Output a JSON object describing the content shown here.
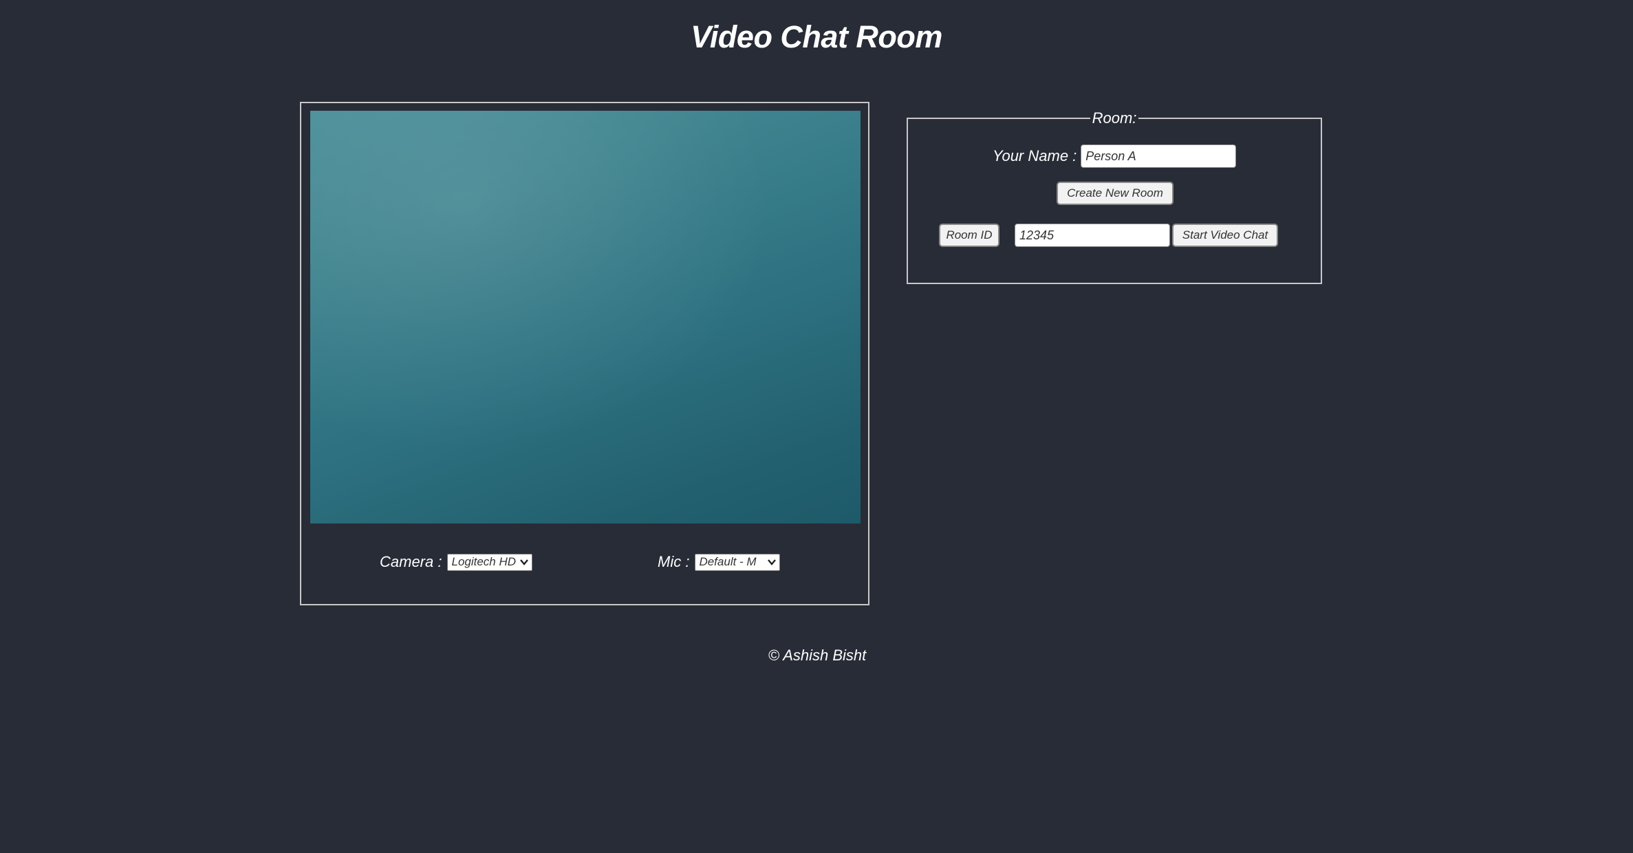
{
  "page": {
    "title": "Video Chat Room",
    "footer": "© Ashish Bisht"
  },
  "video": {
    "camera_label": "Camera :",
    "camera_selected": "Logitech HD",
    "mic_label": "Mic :",
    "mic_selected": "Default - M"
  },
  "room": {
    "legend": "Room:",
    "name_label": "Your Name :",
    "name_value": "Person A",
    "create_button": "Create New Room",
    "room_id_button": "Room ID",
    "room_id_value": "12345",
    "start_button": "Start Video Chat"
  },
  "colors": {
    "background": "#282c36",
    "video_tint": "#2f7382",
    "border": "#c8c8c8"
  },
  "icons": [
    "chevron-down-icon"
  ]
}
